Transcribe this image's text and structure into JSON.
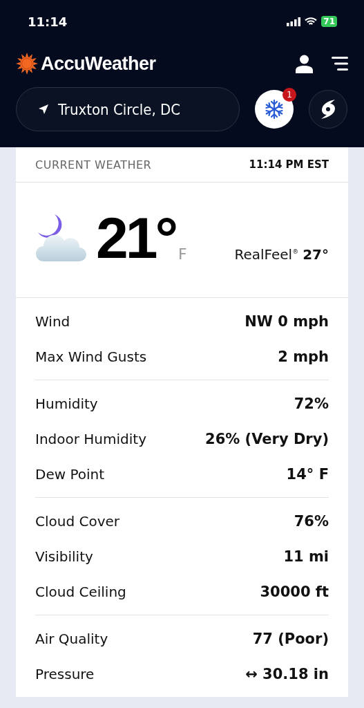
{
  "status_bar": {
    "time": "11:14",
    "battery": "71"
  },
  "header": {
    "logo": "AccuWeather",
    "location": "Truxton Circle, DC",
    "alert_count": "1"
  },
  "current": {
    "title": "CURRENT WEATHER",
    "time": "11:14 PM EST",
    "temperature": "21°",
    "unit": "F",
    "realfeel_label": "RealFeel$^{®}$",
    "realfeel_value": "27°"
  },
  "groups": [
    [
      {
        "label": "Wind",
        "value": "NW 0 mph"
      },
      {
        "label": "Max Wind Gusts",
        "value": "2 mph"
      }
    ],
    [
      {
        "label": "Humidity",
        "value": "72%"
      },
      {
        "label": "Indoor Humidity",
        "value": "26% (Very Dry)"
      },
      {
        "label": "Dew Point",
        "value": "14° F"
      }
    ],
    [
      {
        "label": "Cloud Cover",
        "value": "76%"
      },
      {
        "label": "Visibility",
        "value": "11 mi"
      },
      {
        "label": "Cloud Ceiling",
        "value": "30000 ft"
      }
    ],
    [
      {
        "label": "Air Quality",
        "value": "77 (Poor)"
      },
      {
        "label": "Pressure",
        "value": "↔ 30.18 in"
      }
    ]
  ]
}
